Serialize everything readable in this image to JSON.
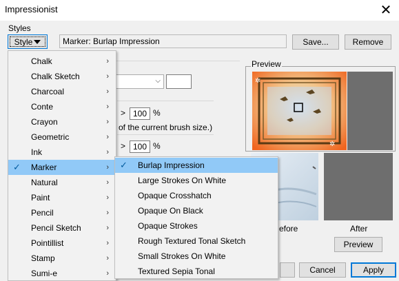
{
  "window": {
    "title": "Impressionist",
    "close_glyph": "✕"
  },
  "styles": {
    "group_label": "Styles",
    "style_button_label": "Style",
    "preset_name": "Marker: Burlap Impression",
    "save_label": "Save...",
    "remove_label": "Remove"
  },
  "options": {
    "percent_1": "100",
    "percent_2": "100",
    "percent_sign": "%",
    "gt_glyph": ">",
    "hint_text": "of the current brush size.)"
  },
  "preview": {
    "label": "Preview",
    "before_label": "efore",
    "after_label": "After",
    "button_label": "Preview"
  },
  "dialog_buttons": {
    "cancel_label": "Cancel",
    "apply_label": "Apply"
  },
  "main_menu": {
    "items": [
      {
        "label": "Chalk",
        "has_sub": true,
        "checked": false,
        "highlighted": false
      },
      {
        "label": "Chalk Sketch",
        "has_sub": true,
        "checked": false,
        "highlighted": false
      },
      {
        "label": "Charcoal",
        "has_sub": true,
        "checked": false,
        "highlighted": false
      },
      {
        "label": "Conte",
        "has_sub": true,
        "checked": false,
        "highlighted": false
      },
      {
        "label": "Crayon",
        "has_sub": true,
        "checked": false,
        "highlighted": false
      },
      {
        "label": "Geometric",
        "has_sub": true,
        "checked": false,
        "highlighted": false
      },
      {
        "label": "Ink",
        "has_sub": true,
        "checked": false,
        "highlighted": false
      },
      {
        "label": "Marker",
        "has_sub": true,
        "checked": true,
        "highlighted": true
      },
      {
        "label": "Natural",
        "has_sub": true,
        "checked": false,
        "highlighted": false
      },
      {
        "label": "Paint",
        "has_sub": true,
        "checked": false,
        "highlighted": false
      },
      {
        "label": "Pencil",
        "has_sub": true,
        "checked": false,
        "highlighted": false
      },
      {
        "label": "Pencil Sketch",
        "has_sub": true,
        "checked": false,
        "highlighted": false
      },
      {
        "label": "Pointillist",
        "has_sub": true,
        "checked": false,
        "highlighted": false
      },
      {
        "label": "Stamp",
        "has_sub": true,
        "checked": false,
        "highlighted": false
      },
      {
        "label": "Sumi-e",
        "has_sub": true,
        "checked": false,
        "highlighted": false
      }
    ]
  },
  "sub_menu": {
    "items": [
      {
        "label": "Burlap Impression",
        "checked": true,
        "highlighted": true
      },
      {
        "label": "Large Strokes On White",
        "checked": false,
        "highlighted": false
      },
      {
        "label": "Opaque Crosshatch",
        "checked": false,
        "highlighted": false
      },
      {
        "label": "Opaque On Black",
        "checked": false,
        "highlighted": false
      },
      {
        "label": "Opaque Strokes",
        "checked": false,
        "highlighted": false
      },
      {
        "label": "Rough Textured Tonal Sketch",
        "checked": false,
        "highlighted": false
      },
      {
        "label": "Small Strokes On White",
        "checked": false,
        "highlighted": false
      },
      {
        "label": "Textured Sepia Tonal",
        "checked": false,
        "highlighted": false
      }
    ]
  },
  "glyphs": {
    "check": "✓",
    "submenu_arrow": "›",
    "combo_chevron": "⌵"
  },
  "colors": {
    "highlight": "#91c9f7",
    "accent": "#0078d7",
    "preview_gray": "#6e6e6e"
  }
}
